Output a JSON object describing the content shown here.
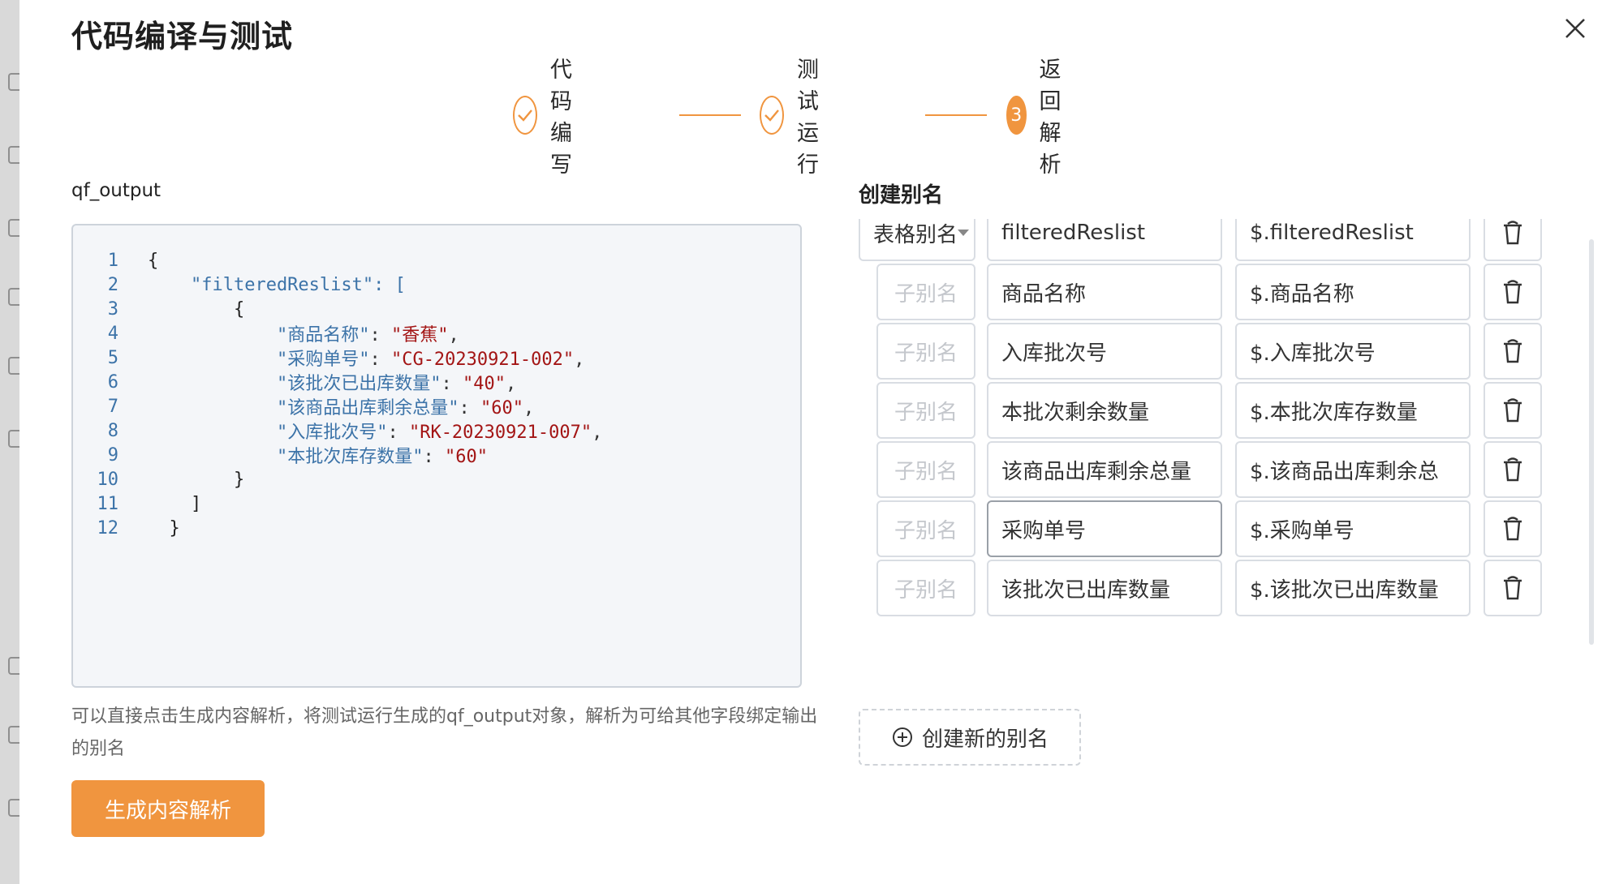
{
  "modal": {
    "title": "代码编译与测试"
  },
  "steps": [
    {
      "label": "代码编写",
      "state": "done"
    },
    {
      "label": "测试运行",
      "state": "done"
    },
    {
      "label": "返回解析",
      "state": "active",
      "number": "3"
    }
  ],
  "code_pane": {
    "label": "qf_output",
    "lines": [
      {
        "n": "1",
        "text": "{"
      },
      {
        "n": "2",
        "text": "    \"filteredReslist\": ["
      },
      {
        "n": "3",
        "text": "        {"
      },
      {
        "n": "4",
        "key": "\"商品名称\"",
        "val": "\"香蕉\"",
        "indent": "            "
      },
      {
        "n": "5",
        "key": "\"采购单号\"",
        "val": "\"CG-20230921-002\"",
        "indent": "            "
      },
      {
        "n": "6",
        "key": "\"该批次已出库数量\"",
        "val": "\"40\"",
        "indent": "            "
      },
      {
        "n": "7",
        "key": "\"该商品出库剩余总量\"",
        "val": "\"60\"",
        "indent": "            "
      },
      {
        "n": "8",
        "key": "\"入库批次号\"",
        "val": "\"RK-20230921-007\"",
        "indent": "            "
      },
      {
        "n": "9",
        "key": "\"本批次库存数量\"",
        "val": "\"60\"",
        "indent": "            ",
        "last": true
      },
      {
        "n": "10",
        "text": "        }"
      },
      {
        "n": "11",
        "text": "    ]"
      },
      {
        "n": "12",
        "text": "  }"
      }
    ],
    "hint": "可以直接点击生成内容解析，将测试运行生成的qf_output对象，解析为可给其他字段绑定输出的别名",
    "generate_button": "生成内容解析"
  },
  "alias_pane": {
    "title": "创建别名",
    "table_row": {
      "type_label": "表格别名",
      "name": "filteredReslist",
      "path": "$.filteredReslist"
    },
    "sub_placeholder": "子别名",
    "rows": [
      {
        "name": "商品名称",
        "path": "$.商品名称"
      },
      {
        "name": "入库批次号",
        "path": "$.入库批次号"
      },
      {
        "name": "本批次剩余数量",
        "path": "$.本批次库存数量"
      },
      {
        "name": "该商品出库剩余总量",
        "path": "$.该商品出库剩余总"
      },
      {
        "name": "采购单号",
        "path": "$.采购单号",
        "focus": true
      },
      {
        "name": "该批次已出库数量",
        "path": "$.该批次已出库数量"
      }
    ],
    "add_button": "创建新的别名"
  },
  "colors": {
    "accent": "#f0953f",
    "code_key": "#3c73a8",
    "code_string": "#a31515"
  }
}
